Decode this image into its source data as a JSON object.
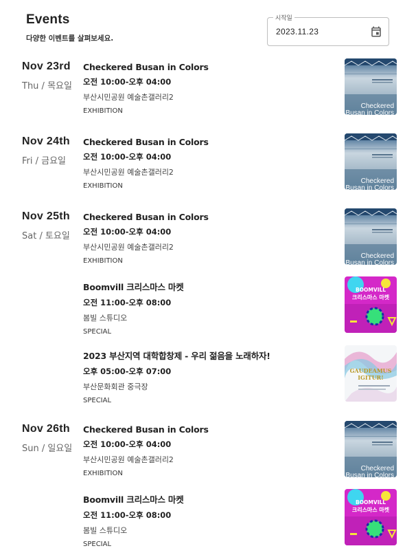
{
  "header": {
    "title": "Events",
    "subtitle": "다양한 이벤트를 살펴보세요."
  },
  "date_filter": {
    "label": "시작일",
    "value": "2023.11.23",
    "icon": "calendar-icon"
  },
  "poster_texts": {
    "busan": "Checkered\nBusan in Colors",
    "boomvill": "BOOMVILL\n크리스마스 마켓",
    "gaudeamus": "GAUDEAMUS IGITUR!"
  },
  "days": [
    {
      "date": "Nov 23rd",
      "weekday": "Thu / 목요일",
      "events": [
        {
          "title": "Checkered Busan in Colors",
          "time": "오전 10:00-오후 04:00",
          "place": "부산시민공원 예술촌갤러리2",
          "category": "EXHIBITION",
          "thumb": "busan"
        }
      ]
    },
    {
      "date": "Nov 24th",
      "weekday": "Fri / 금요일",
      "events": [
        {
          "title": "Checkered Busan in Colors",
          "time": "오전 10:00-오후 04:00",
          "place": "부산시민공원 예술촌갤러리2",
          "category": "EXHIBITION",
          "thumb": "busan"
        }
      ]
    },
    {
      "date": "Nov 25th",
      "weekday": "Sat / 토요일",
      "events": [
        {
          "title": "Checkered Busan in Colors",
          "time": "오전 10:00-오후 04:00",
          "place": "부산시민공원 예술촌갤러리2",
          "category": "EXHIBITION",
          "thumb": "busan"
        },
        {
          "title": "Boomvill 크리스마스 마켓",
          "time": "오전 11:00-오후 08:00",
          "place": "봄빌 스튜디오",
          "category": "SPECIAL",
          "thumb": "boomvill"
        },
        {
          "title": "2023 부산지역 대학합창제 - 우리 젊음을 노래하자!",
          "time": "오후 05:00-오후 07:00",
          "place": "부산문화회관 중극장",
          "category": "SPECIAL",
          "thumb": "gaudeamus"
        }
      ]
    },
    {
      "date": "Nov 26th",
      "weekday": "Sun / 일요일",
      "events": [
        {
          "title": "Checkered Busan in Colors",
          "time": "오전 10:00-오후 04:00",
          "place": "부산시민공원 예술촌갤러리2",
          "category": "EXHIBITION",
          "thumb": "busan"
        },
        {
          "title": "Boomvill 크리스마스 마켓",
          "time": "오전 11:00-오후 08:00",
          "place": "봄빌 스튜디오",
          "category": "SPECIAL",
          "thumb": "boomvill"
        }
      ]
    }
  ]
}
